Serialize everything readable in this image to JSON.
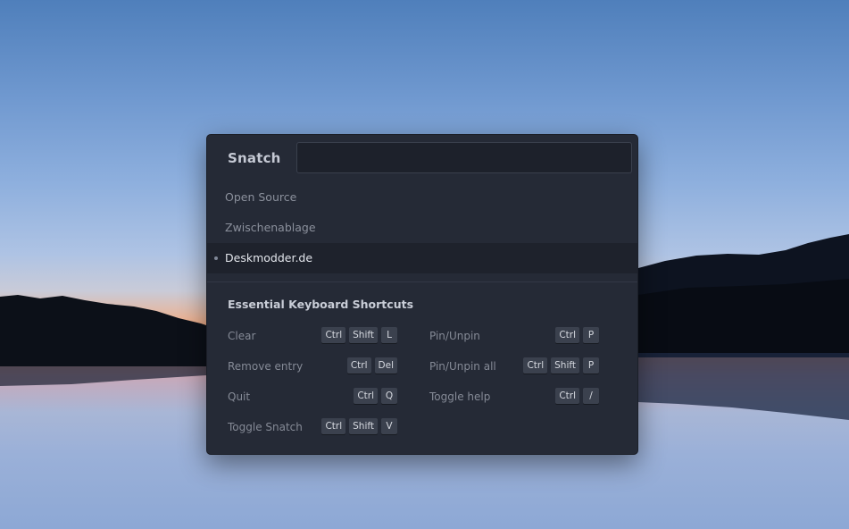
{
  "app": {
    "title": "Snatch",
    "search": {
      "value": "",
      "placeholder": ""
    }
  },
  "clipboard_items": [
    {
      "text": "Open Source",
      "active": false
    },
    {
      "text": "Zwischenablage",
      "active": false
    },
    {
      "text": "Deskmodder.de",
      "active": true
    }
  ],
  "help": {
    "title": "Essential Keyboard Shortcuts",
    "shortcuts": [
      {
        "label": "Clear",
        "keys": [
          "Ctrl",
          "Shift",
          "L"
        ]
      },
      {
        "label": "Remove entry",
        "keys": [
          "Ctrl",
          "Del"
        ]
      },
      {
        "label": "Quit",
        "keys": [
          "Ctrl",
          "Q"
        ]
      },
      {
        "label": "Toggle Snatch",
        "keys": [
          "Ctrl",
          "Shift",
          "V"
        ]
      },
      {
        "label": "Pin/Unpin",
        "keys": [
          "Ctrl",
          "P"
        ]
      },
      {
        "label": "Pin/Unpin all",
        "keys": [
          "Ctrl",
          "Shift",
          "P"
        ]
      },
      {
        "label": "Toggle help",
        "keys": [
          "Ctrl",
          "/"
        ]
      }
    ]
  },
  "colors": {
    "panel_bg": "#252a36",
    "input_bg": "#1d212b",
    "active_row_bg": "#1e222c",
    "key_bg": "#3b414e"
  }
}
